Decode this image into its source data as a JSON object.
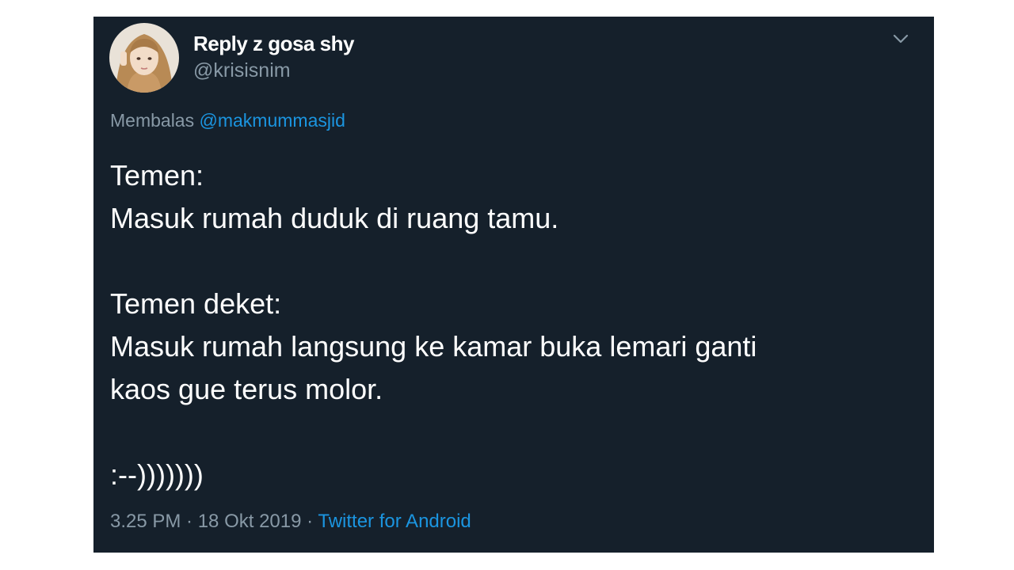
{
  "tweet": {
    "author": {
      "display_name": "Reply z gosa shy",
      "handle": "@krisisnim"
    },
    "reply_to": {
      "prefix": "Membalas",
      "mention": "@makmummasjid"
    },
    "text_lines": [
      "Temen:",
      "Masuk rumah duduk di ruang tamu.",
      "",
      "Temen deket:",
      "Masuk rumah langsung ke kamar buka lemari ganti",
      "kaos gue terus molor.",
      "",
      ":--)))))))"
    ],
    "timestamp": "3.25 PM · 18 Okt 2019 ·",
    "source": "Twitter for Android"
  },
  "icons": {
    "caret": "chevron-down-icon",
    "avatar": "profile-photo"
  },
  "colors": {
    "background": "#15202b",
    "text": "#ffffff",
    "muted": "#8899a6",
    "link": "#1b95e0"
  }
}
